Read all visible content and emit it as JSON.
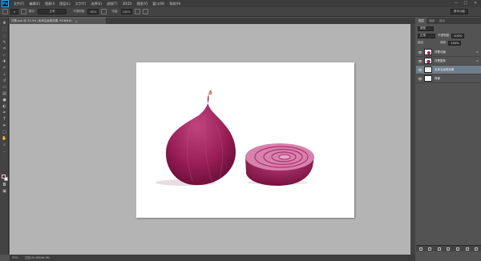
{
  "app": {
    "logo": "Ps"
  },
  "menubar": {
    "items": [
      "文件(F)",
      "编辑(E)",
      "图像(I)",
      "图层(L)",
      "文字(Y)",
      "选择(S)",
      "滤镜(T)",
      "3D(D)",
      "视图(V)",
      "窗口(W)",
      "帮助(H)"
    ],
    "window_controls": [
      "—",
      "□",
      "✕"
    ]
  },
  "options": {
    "mode_label": "模式:",
    "mode_value": "正常",
    "opacity_label": "不透明度:",
    "opacity_value": "80%",
    "flow_label": "流量:",
    "flow_value": "100%",
    "workspace": "基本功能"
  },
  "document": {
    "tab_title": "洋葱.psd @ 33.3% (未命名画笔效果, RGB/8#)",
    "tab_close": "×"
  },
  "status": {
    "zoom": "33%",
    "doc_info": "文档:20.6M/46.9M"
  },
  "layers_panel": {
    "tabs": [
      "图层",
      "通道",
      "路径"
    ],
    "kind_label": "类型",
    "blend_mode": "正常",
    "opacity_label": "不透明度:",
    "opacity_value": "100%",
    "lock_label": "锁定:",
    "fill_label": "填充:",
    "fill_value": "100%",
    "layers": [
      {
        "name": "洋葱切面",
        "fx": "fx",
        "active": false
      },
      {
        "name": "洋葱整体",
        "fx": "fx",
        "active": false
      },
      {
        "name": "未命名画笔效果",
        "fx": "",
        "active": true
      },
      {
        "name": "背景",
        "fx": "",
        "active": false
      }
    ]
  },
  "colors": {
    "foreground": "#7a1035",
    "background": "#ffffff",
    "onion": "#9a1f56"
  }
}
